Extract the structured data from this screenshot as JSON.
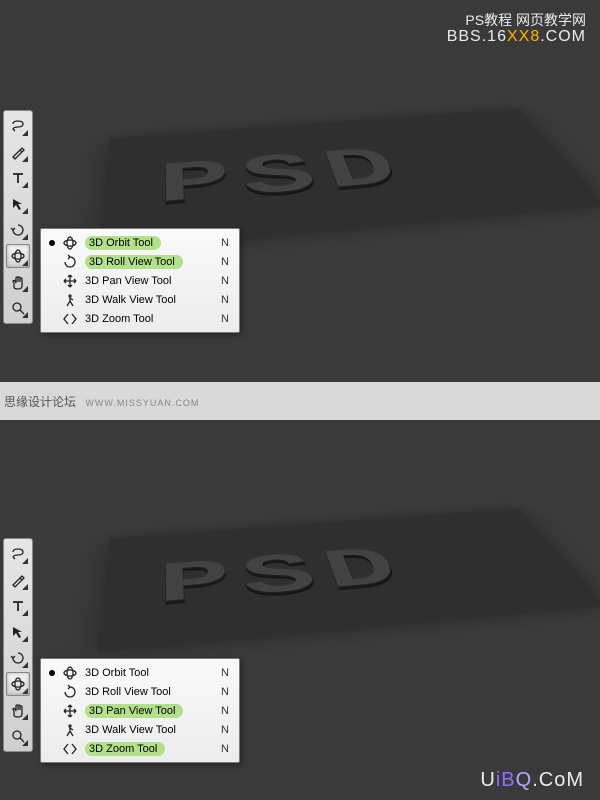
{
  "watermarks": {
    "top_line1": "PS教程 网页教学网",
    "top_line2_pre": "BBS.16",
    "top_line2_accent": "XX8",
    "top_line2_post": ".COM",
    "middle_main": "思缘设计论坛",
    "middle_sub": "WWW.MISSYUAN.COM",
    "bottom_pre": "U",
    "bottom_mid": "iB",
    "bottom_q": "Q",
    "bottom_post": ".CoM"
  },
  "psd_text": "PSD",
  "flyout_top": {
    "items": [
      {
        "label": "3D Orbit Tool",
        "shortcut": "N",
        "current": true,
        "highlight": true,
        "icon": "orbit"
      },
      {
        "label": "3D Roll View Tool",
        "shortcut": "N",
        "current": false,
        "highlight": true,
        "icon": "roll"
      },
      {
        "label": "3D Pan View Tool",
        "shortcut": "N",
        "current": false,
        "highlight": false,
        "icon": "pan"
      },
      {
        "label": "3D Walk View Tool",
        "shortcut": "N",
        "current": false,
        "highlight": false,
        "icon": "walk"
      },
      {
        "label": "3D Zoom Tool",
        "shortcut": "N",
        "current": false,
        "highlight": false,
        "icon": "zoom3d"
      }
    ]
  },
  "flyout_bottom": {
    "items": [
      {
        "label": "3D Orbit Tool",
        "shortcut": "N",
        "current": true,
        "highlight": false,
        "icon": "orbit"
      },
      {
        "label": "3D Roll View Tool",
        "shortcut": "N",
        "current": false,
        "highlight": false,
        "icon": "roll"
      },
      {
        "label": "3D Pan View Tool",
        "shortcut": "N",
        "current": false,
        "highlight": true,
        "icon": "pan"
      },
      {
        "label": "3D Walk View Tool",
        "shortcut": "N",
        "current": false,
        "highlight": false,
        "icon": "walk"
      },
      {
        "label": "3D Zoom Tool",
        "shortcut": "N",
        "current": false,
        "highlight": true,
        "icon": "zoom3d"
      }
    ]
  },
  "toolbox": [
    {
      "name": "lasso-tool",
      "icon": "lasso"
    },
    {
      "name": "pen-tool",
      "icon": "pen"
    },
    {
      "name": "type-tool",
      "icon": "type"
    },
    {
      "name": "path-selection-tool",
      "icon": "arrow"
    },
    {
      "name": "3d-rotate-tool",
      "icon": "rotate3d"
    },
    {
      "name": "3d-orbit-tool",
      "icon": "orbit",
      "selected": true
    },
    {
      "name": "hand-tool",
      "icon": "hand"
    },
    {
      "name": "zoom-tool",
      "icon": "zoom"
    }
  ]
}
